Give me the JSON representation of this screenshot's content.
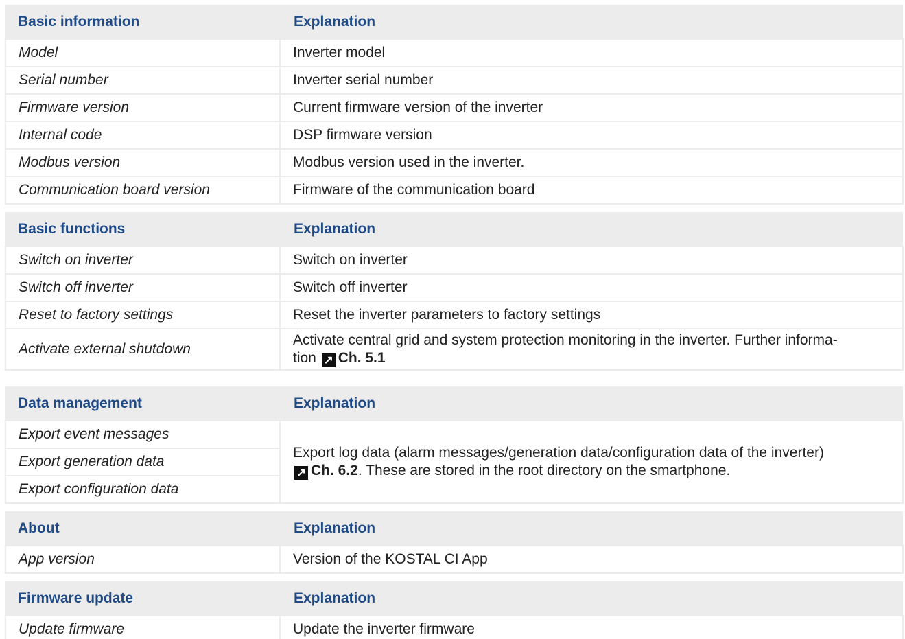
{
  "sections": [
    {
      "header": [
        "Basic information",
        "Explanation"
      ],
      "rows": [
        [
          "Model",
          "Inverter model"
        ],
        [
          "Serial number",
          "Inverter serial number"
        ],
        [
          "Firmware version",
          "Current firmware version of the inverter"
        ],
        [
          "Internal code",
          "DSP firmware version"
        ],
        [
          "Modbus version",
          "Modbus version used in the inverter."
        ],
        [
          "Communication board version",
          "Firmware of the communication board"
        ]
      ]
    },
    {
      "header": [
        "Basic functions",
        "Explanation"
      ],
      "rows": [
        [
          "Switch on inverter",
          "Switch on inverter"
        ],
        [
          "Switch off inverter",
          "Switch off inverter"
        ],
        [
          "Reset to factory settings",
          "Reset the inverter parameters to factory settings"
        ],
        [
          "Activate external shutdown",
          ""
        ]
      ],
      "shutdown_text": "Activate central grid and system protection monitoring in the inverter. Further informa-",
      "shutdown_text2": "tion",
      "shutdown_ref": "Ch. 5.1"
    },
    {
      "header": [
        "Data management",
        "Explanation"
      ],
      "rows": [
        [
          "Export event messages"
        ],
        [
          "Export generation data"
        ],
        [
          "Export configuration data"
        ]
      ],
      "export_text": "Export log data (alarm messages/generation data/configuration data of the inverter)",
      "export_ref": "Ch. 6.2",
      "export_text2": ". These are stored in the root directory on the smartphone."
    },
    {
      "header": [
        "About",
        "Explanation"
      ],
      "rows": [
        [
          "App version",
          "Version of the KOSTAL CI App"
        ]
      ]
    },
    {
      "header": [
        "Firmware update",
        "Explanation"
      ],
      "rows": [
        [
          "Update firmware",
          "Update the inverter firmware"
        ]
      ]
    }
  ],
  "icons": {
    "ref_arrow": "arrow-up-right-icon",
    "ref_arrow_glyph": "↗"
  }
}
